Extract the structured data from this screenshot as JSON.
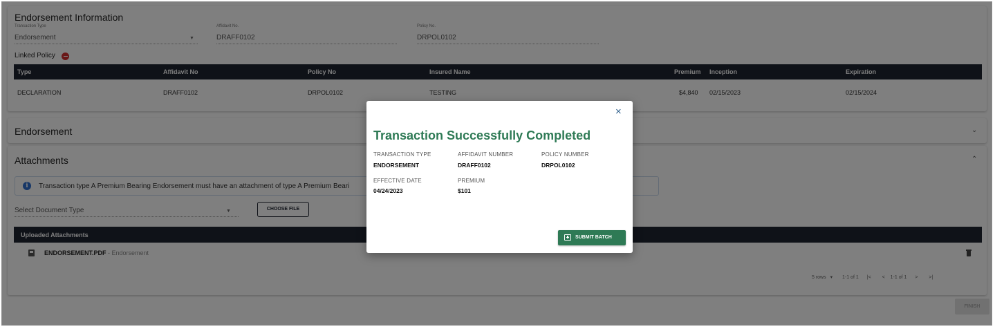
{
  "endorsement_info": {
    "title": "Endorsement Information",
    "transaction_type_label": "Transaction Type",
    "transaction_type_value": "Endorsement",
    "affidavit_label": "Affidavit No.",
    "affidavit_value": "DRAFF0102",
    "policy_label": "Policy No.",
    "policy_value": "DRPOL0102",
    "linked_policy_label": "Linked Policy",
    "table": {
      "headers": [
        "Type",
        "Affidavit No",
        "Policy No",
        "Insured Name",
        "Premium",
        "Inception",
        "Expiration"
      ],
      "row": [
        "DECLARATION",
        "DRAFF0102",
        "DRPOL0102",
        "TESTING",
        "$4,840",
        "02/15/2023",
        "02/15/2024"
      ]
    }
  },
  "endorsement_section": {
    "title": "Endorsement"
  },
  "attachments": {
    "title": "Attachments",
    "info_message": "Transaction type A Premium Bearing Endorsement must have an attachment of type A Premium Beari",
    "select_placeholder": "Select Document Type",
    "choose_file_label": "CHOOSE FILE",
    "uploaded_header": "Uploaded Attachments",
    "file_name": "ENDORSEMENT.PDF",
    "file_type": " - Endorsement",
    "pagination": {
      "rows_label": "5 rows",
      "range_label": "1-1 of 1",
      "range_label_2": "1-1 of 1"
    }
  },
  "finish_label": "FINISH",
  "modal": {
    "title": "Transaction Successfully Completed",
    "close_symbol": "×",
    "fields": [
      {
        "label": "TRANSACTION TYPE",
        "value": "ENDORSEMENT"
      },
      {
        "label": "AFFIDAVIT NUMBER",
        "value": "DRAFF0102"
      },
      {
        "label": "POLICY NUMBER",
        "value": "DRPOL0102"
      },
      {
        "label": "EFFECTIVE DATE",
        "value": "04/24/2023"
      },
      {
        "label": "PREMIUM",
        "value": "$101"
      }
    ],
    "submit_label": "SUBMIT BATCH"
  },
  "colors": {
    "success_green": "#2e7a55",
    "table_header": "#1f2430",
    "overlay": "rgba(0,0,0,0.5)",
    "remove_red": "#d32f2f"
  },
  "icons": [
    "minus-circle-icon",
    "info-icon",
    "chevron-down-icon",
    "chevron-up-icon",
    "pdf-file-icon",
    "trash-icon",
    "close-icon",
    "submit-batch-icon"
  ]
}
